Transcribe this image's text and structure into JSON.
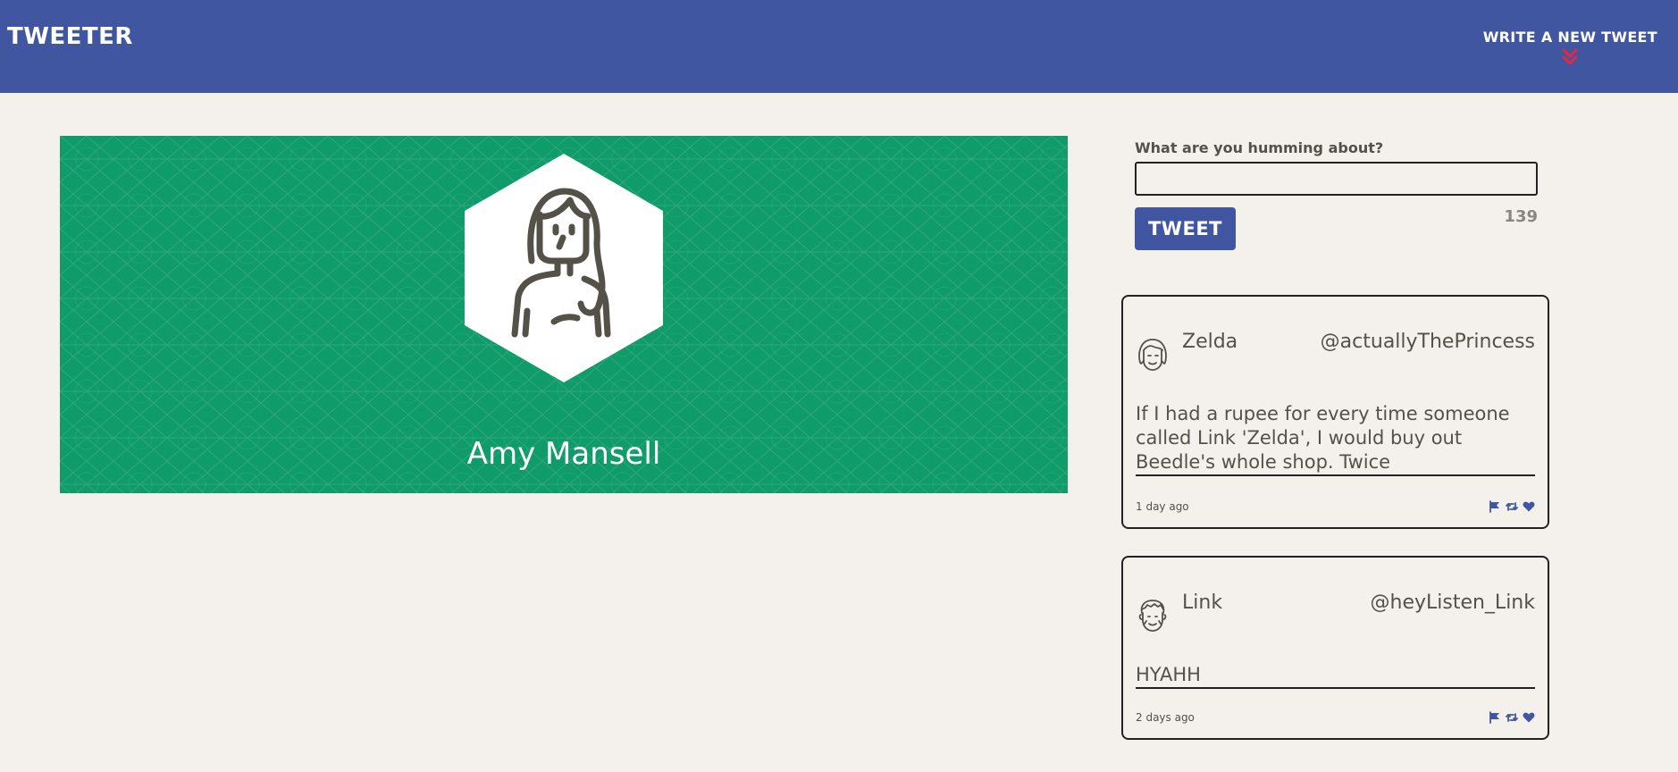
{
  "nav": {
    "brand": "Tweeter",
    "compose_label": "Write a new tweet",
    "compose_icon": "double-chevron-down-icon"
  },
  "profile": {
    "name": "Amy Mansell",
    "avatar_icon": "woman-avatar-icon"
  },
  "new_tweet": {
    "label": "What are you humming about?",
    "value": "",
    "placeholder": "",
    "button_label": "Tweet",
    "counter": "139"
  },
  "tweets": [
    {
      "name": "Zelda",
      "handle": "@actuallyThePrincess",
      "text": "If I had a rupee for every time someone called Link 'Zelda', I would buy out Beedle's whole shop. Twice",
      "time": "1 day ago",
      "avatar_icon": "girl-avatar-icon"
    },
    {
      "name": "Link",
      "handle": "@heyListen_Link",
      "text": "HYAHH",
      "time": "2 days ago",
      "avatar_icon": "boy-avatar-icon"
    }
  ],
  "colors": {
    "nav_bg": "#4056a1",
    "accent_red": "#e8283a",
    "banner_green": "#0f9b6a",
    "page_bg": "#f4f1ec",
    "action_icon": "#4056a1"
  }
}
